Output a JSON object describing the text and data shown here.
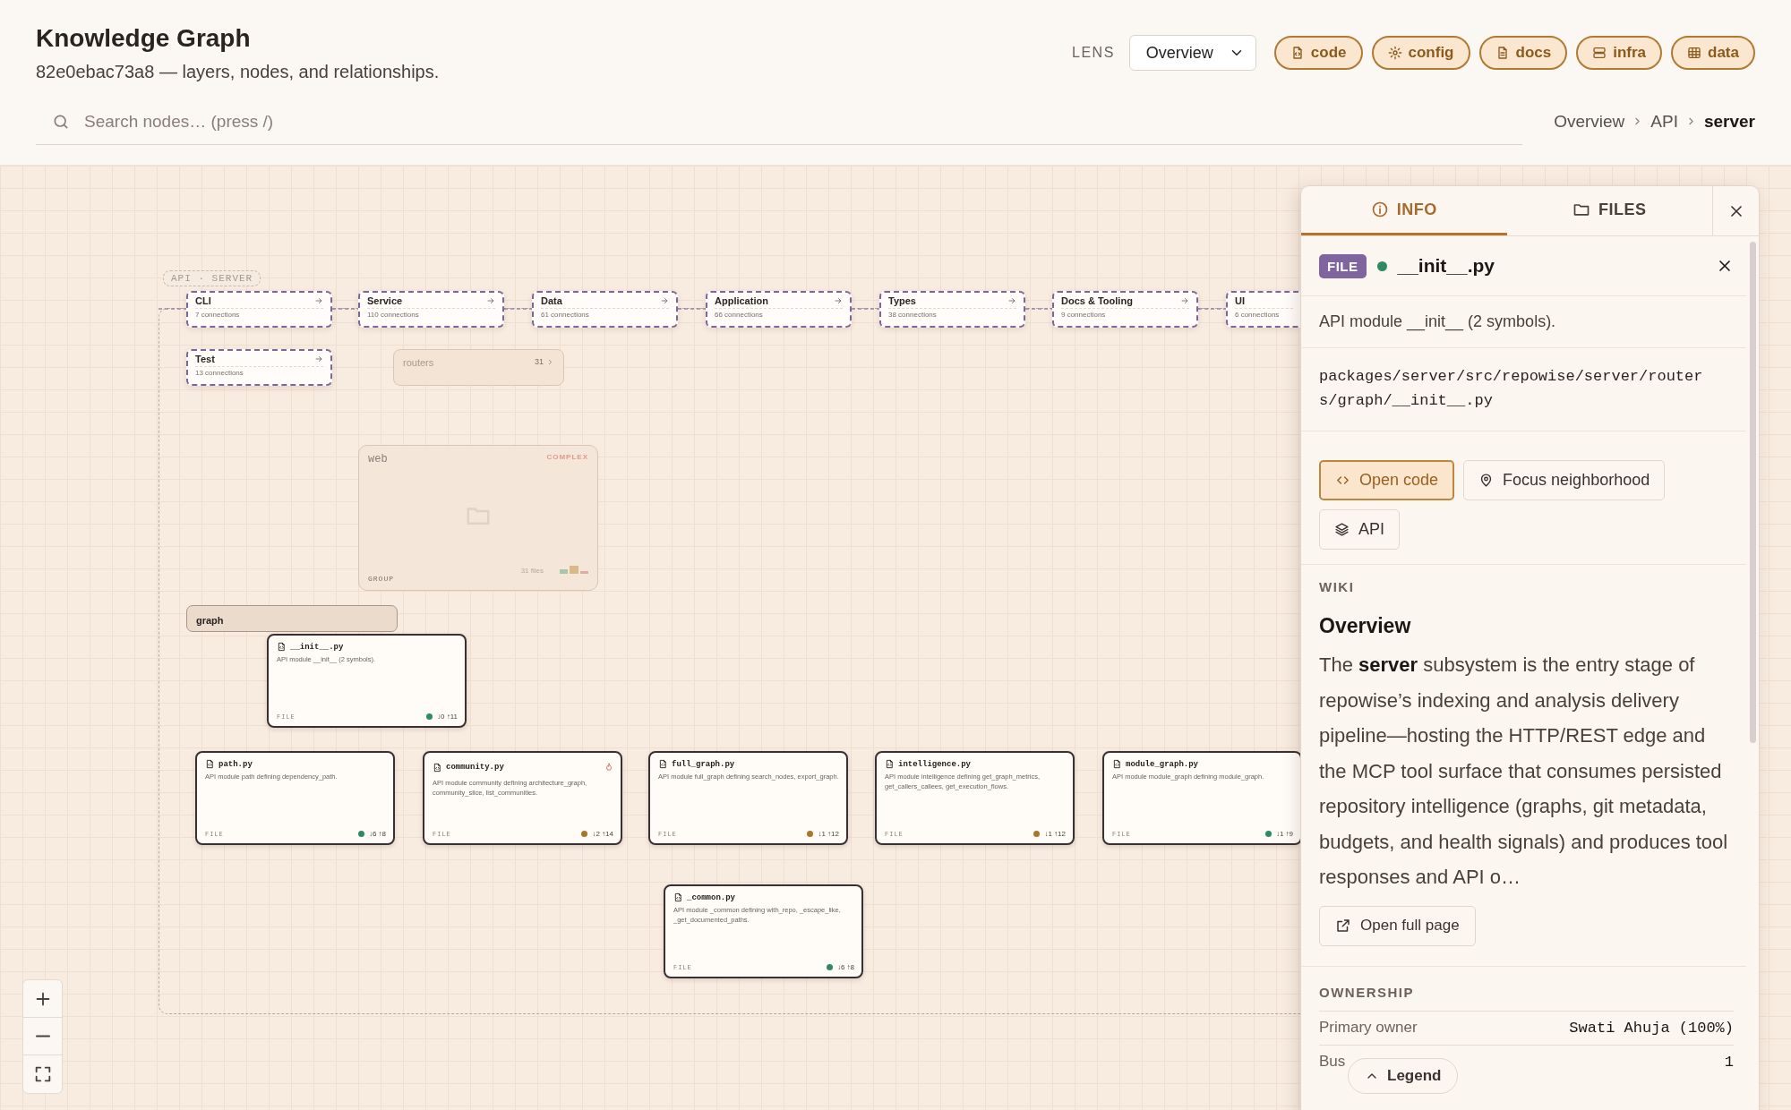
{
  "header": {
    "title": "Knowledge Graph",
    "subtitle": "82e0ebac73a8 — layers, nodes, and relationships.",
    "lens": {
      "label": "LENS",
      "value": "Overview"
    },
    "chips": [
      {
        "label": "code",
        "kind": "file"
      },
      {
        "label": "config",
        "kind": "gear"
      },
      {
        "label": "docs",
        "kind": "doc"
      },
      {
        "label": "infra",
        "kind": "server"
      },
      {
        "label": "data",
        "kind": "table"
      }
    ]
  },
  "search": {
    "placeholder": "Search nodes… (press /)"
  },
  "breadcrumb": [
    {
      "label": "Overview",
      "current": false
    },
    {
      "label": "API",
      "current": false
    },
    {
      "label": "server",
      "current": true
    }
  ],
  "canvas": {
    "group_label": "API · SERVER",
    "layers": [
      {
        "name": "CLI",
        "connections": "7 connections"
      },
      {
        "name": "Service",
        "connections": "110 connections"
      },
      {
        "name": "Data",
        "connections": "61 connections"
      },
      {
        "name": "Application",
        "connections": "66 connections"
      },
      {
        "name": "Types",
        "connections": "38 connections"
      },
      {
        "name": "Docs & Tooling",
        "connections": "9 connections"
      },
      {
        "name": "UI",
        "connections": "6 connections"
      },
      {
        "name": "Test",
        "connections": "13 connections"
      }
    ],
    "folders": [
      {
        "kind": "collapsed",
        "name": "routers",
        "count": "31"
      },
      {
        "kind": "group",
        "name": "web",
        "badge": "COMPLEX",
        "files": "31 files",
        "type_label": "GROUP"
      },
      {
        "kind": "bar",
        "name": "graph"
      }
    ],
    "files": [
      {
        "name": "__init__.py",
        "description": "API module __init__ (2 symbols).",
        "type_label": "FILE",
        "color": "#2f8a62",
        "stats": "↓0 ↑11",
        "hot": false
      },
      {
        "name": "path.py",
        "description": "API module path defining dependency_path.",
        "type_label": "FILE",
        "color": "#2f8a62",
        "stats": "↓6 ↑8",
        "hot": false
      },
      {
        "name": "community.py",
        "description": "API module community defining architecture_graph, community_slice, list_communities.",
        "type_label": "FILE",
        "color": "#a8772c",
        "stats": "↓2 ↑14",
        "hot": true
      },
      {
        "name": "full_graph.py",
        "description": "API module full_graph defining search_nodes, export_graph.",
        "type_label": "FILE",
        "color": "#a8772c",
        "stats": "↓1 ↑12",
        "hot": false
      },
      {
        "name": "intelligence.py",
        "description": "API module intelligence defining get_graph_metrics, get_callers_callees, get_execution_flows.",
        "type_label": "FILE",
        "color": "#a8772c",
        "stats": "↓1 ↑12",
        "hot": false
      },
      {
        "name": "module_graph.py",
        "description": "API module module_graph defining module_graph.",
        "type_label": "FILE",
        "color": "#2f8a62",
        "stats": "↓1 ↑9",
        "hot": false
      },
      {
        "name": "_common.py",
        "description": "API module _common defining with_repo, _escape_like, _get_documented_paths.",
        "type_label": "FILE",
        "color": "#2f8a62",
        "stats": "↓6 ↑8",
        "hot": false
      }
    ]
  },
  "panel": {
    "tabs": [
      {
        "label": "INFO",
        "kind": "info",
        "selected": true
      },
      {
        "label": "FILES",
        "kind": "folder",
        "selected": false
      }
    ],
    "node": {
      "badge": "FILE",
      "color": "#2f8a62",
      "title": "__init__.py",
      "description": "API module __init__ (2 symbols).",
      "path": "packages/server/src/repowise/server/routers/graph/__init__.py"
    },
    "actions": [
      {
        "label": "Open code",
        "kind": "code",
        "primary": true
      },
      {
        "label": "Focus neighborhood",
        "kind": "pin",
        "primary": false
      },
      {
        "label": "API",
        "kind": "layers",
        "primary": false
      }
    ],
    "wiki": {
      "heading": "WIKI",
      "title": "Overview",
      "text": "The **server** subsystem is the entry stage of repowise’s indexing and analysis delivery pipeline—hosting the HTTP/REST edge and the MCP tool surface that consumes persisted repository intelligence (graphs, git metadata, budgets, and health signals) and produces tool responses and API o…",
      "link": "Open full page"
    },
    "ownership": {
      "heading": "OWNERSHIP",
      "rows": [
        {
          "label": "Primary owner",
          "value": "Swati Ahuja (100%)"
        },
        {
          "label": "Bus",
          "value": "1"
        }
      ]
    },
    "legend": "Legend"
  }
}
